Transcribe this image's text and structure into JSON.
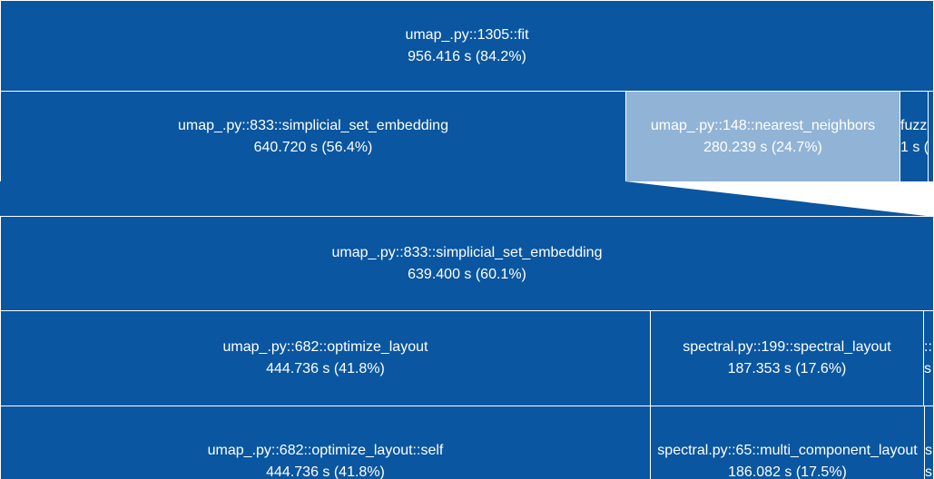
{
  "colors": {
    "node": "#0a56a0",
    "selected": "#91b4d6",
    "border": "#ffffff",
    "text": "#ffffff"
  },
  "top": {
    "fit": {
      "label": "umap_.py::1305::fit",
      "value": "956.416 s (84.2%)"
    },
    "embedding": {
      "label": "umap_.py::833::simplicial_set_embedding",
      "value": "640.720 s (56.4%)"
    },
    "nearest_neighbors": {
      "label": "umap_.py::148::nearest_neighbors",
      "value": "280.239 s (24.7%)"
    },
    "fuzzy": {
      "label": "fuzz",
      "value": "1 s ("
    }
  },
  "zoom": {
    "embedding": {
      "label": "umap_.py::833::simplicial_set_embedding",
      "value": "639.400 s (60.1%)"
    },
    "optimize_layout": {
      "label": "umap_.py::682::optimize_layout",
      "value": "444.736 s (41.8%)"
    },
    "spectral_layout": {
      "label": "spectral.py::199::spectral_layout",
      "value": "187.353 s (17.6%)"
    },
    "small_1": {
      "label": "::",
      "value": "s"
    },
    "optimize_self": {
      "label": "umap_.py::682::optimize_layout::self",
      "value": "444.736 s (41.8%)"
    },
    "multi_component": {
      "label": "spectral.py::65::multi_component_layout",
      "value": "186.082 s (17.5%)"
    },
    "small_2": {
      "label": "s",
      "value": "s"
    }
  }
}
